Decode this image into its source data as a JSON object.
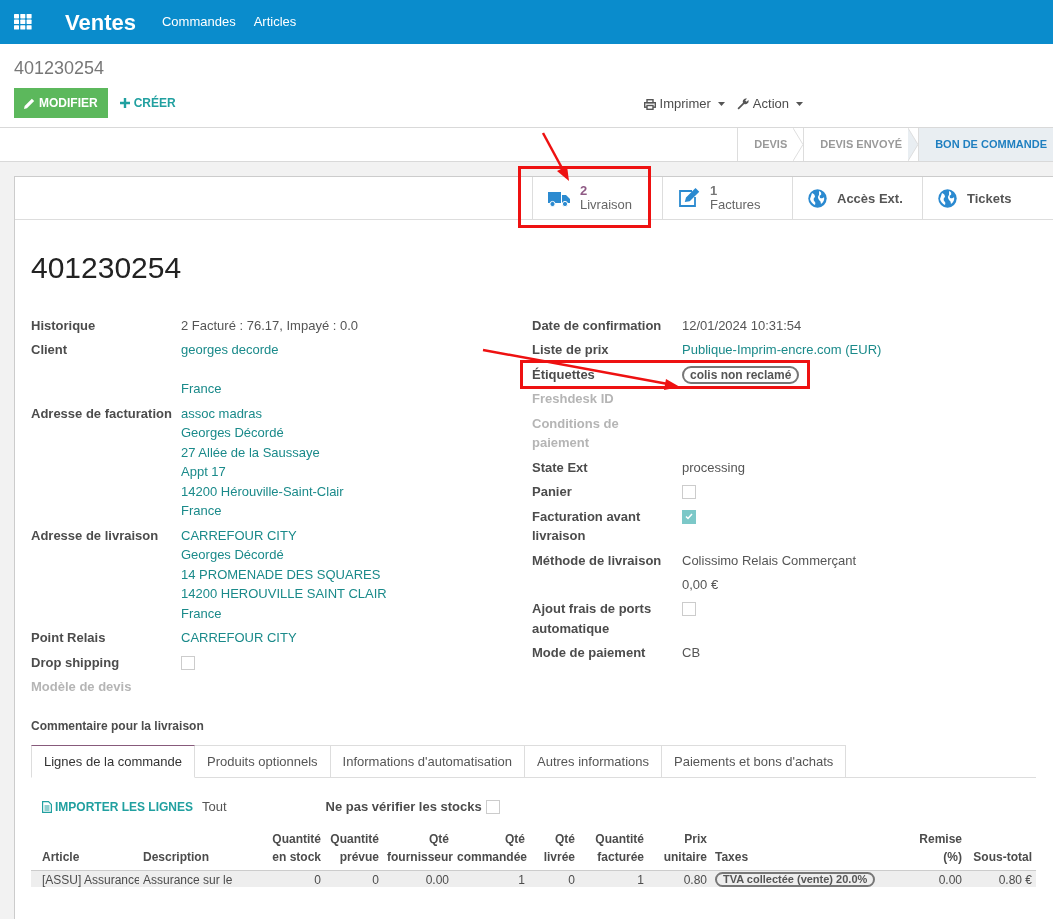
{
  "app": {
    "name": "Ventes",
    "menu": [
      "Commandes",
      "Articles"
    ]
  },
  "breadcrumb": "401230254",
  "actions": {
    "edit": "MODIFIER",
    "create": "CRÉER",
    "print": "Imprimer",
    "action": "Action"
  },
  "statusbar": [
    {
      "label": "DEVIS",
      "selected": false
    },
    {
      "label": "DEVIS ENVOYÉ",
      "selected": false
    },
    {
      "label": "BON DE COMMANDE",
      "selected": true
    }
  ],
  "smart_buttons": [
    {
      "kind": "truck",
      "count": "2",
      "label": "Livraison",
      "highlighted": true
    },
    {
      "kind": "edit",
      "count": "1",
      "label": "Factures",
      "highlighted": false
    },
    {
      "kind": "globe",
      "label": "Accès Ext.",
      "highlighted": false
    },
    {
      "kind": "globe",
      "label": "Tickets",
      "highlighted": false
    }
  ],
  "title": "401230254",
  "left_fields": [
    {
      "label": "Historique",
      "kind": "text",
      "lines": [
        {
          "text": "2 Facturé : 76.17, Impayé : 0.0"
        }
      ]
    },
    {
      "label": "Client",
      "kind": "link",
      "lines": [
        {
          "text": "georges decorde"
        },
        {
          "text": "France",
          "gap_before": true
        }
      ]
    },
    {
      "label": "Adresse de facturation",
      "kind": "link",
      "lines": [
        {
          "text": "assoc madras"
        },
        {
          "text": "Georges Décordé"
        },
        {
          "text": "27 Allée de la Saussaye"
        },
        {
          "text": "Appt 17"
        },
        {
          "text": "14200 Hérouville-Saint-Clair"
        },
        {
          "text": "France"
        }
      ]
    },
    {
      "label": "Adresse de livraison",
      "kind": "link",
      "lines": [
        {
          "text": "CARREFOUR CITY"
        },
        {
          "text": "Georges Décordé"
        },
        {
          "text": "14 PROMENADE DES SQUARES"
        },
        {
          "text": "14200 HEROUVILLE SAINT CLAIR"
        },
        {
          "text": "France"
        }
      ]
    },
    {
      "label": "Point Relais",
      "kind": "link",
      "lines": [
        {
          "text": "CARREFOUR CITY"
        }
      ]
    },
    {
      "label": "Drop shipping",
      "kind": "checkbox",
      "checked": false
    },
    {
      "label": "Modèle de devis",
      "kind": "empty",
      "dimmed": true
    }
  ],
  "right_fields": [
    {
      "label": "Date de confirmation",
      "kind": "text",
      "lines": [
        {
          "text": "12/01/2024 10:31:54"
        }
      ]
    },
    {
      "label": "Liste de prix",
      "kind": "link",
      "lines": [
        {
          "text": "Publique-Imprim-encre.com (EUR)"
        }
      ]
    },
    {
      "label": "Étiquettes",
      "kind": "tag",
      "lines": [
        {
          "text": "colis non reclamé"
        }
      ],
      "highlighted": true
    },
    {
      "label": "Freshdesk ID",
      "kind": "empty",
      "dimmed": true
    },
    {
      "label": "Conditions de paiement",
      "kind": "empty",
      "dimmed": true
    },
    {
      "label": "State Ext",
      "kind": "text",
      "lines": [
        {
          "text": "processing"
        }
      ]
    },
    {
      "label": "Panier",
      "kind": "checkbox",
      "checked": false
    },
    {
      "label": "Facturation avant livraison",
      "kind": "checkbox",
      "checked": true
    },
    {
      "label": "Méthode de livraison",
      "kind": "text",
      "lines": [
        {
          "text": "Colissimo Relais Commerçant"
        },
        {
          "text": "0,00 €",
          "gap_before": true
        }
      ]
    },
    {
      "label": "Ajout frais de ports automatique",
      "kind": "checkbox",
      "checked": false
    },
    {
      "label": "Mode de paiement",
      "kind": "text",
      "lines": [
        {
          "text": "CB"
        }
      ]
    }
  ],
  "comment_label": "Commentaire pour la livraison",
  "tabs": [
    {
      "label": "Lignes de la commande",
      "selected": true
    },
    {
      "label": "Produits optionnels",
      "selected": false
    },
    {
      "label": "Informations d'automatisation",
      "selected": false
    },
    {
      "label": "Autres informations",
      "selected": false
    },
    {
      "label": "Paiements et bons d'achats",
      "selected": false
    }
  ],
  "lines_toolbar": {
    "import": "IMPORTER LES LIGNES",
    "all": "Tout",
    "no_stock_check": {
      "label": "Ne pas vérifier les stocks",
      "checked": false
    }
  },
  "table": {
    "columns": [
      "Article",
      "Description",
      "Quantité en stock",
      "Quantité prévue",
      "Qté fournisseur",
      "Qté commandée",
      "Qté livrée",
      "Quantité facturée",
      "Prix unitaire",
      "Taxes",
      "Remise (%)",
      "Sous-total"
    ],
    "rows": [
      [
        "[ASSU] Assurance",
        "Assurance sur le",
        "0",
        "0",
        "0.00",
        "1",
        "0",
        "1",
        "0.80",
        "TVA collectée (vente) 20.0%",
        "0.00",
        "0.80 €"
      ]
    ]
  }
}
